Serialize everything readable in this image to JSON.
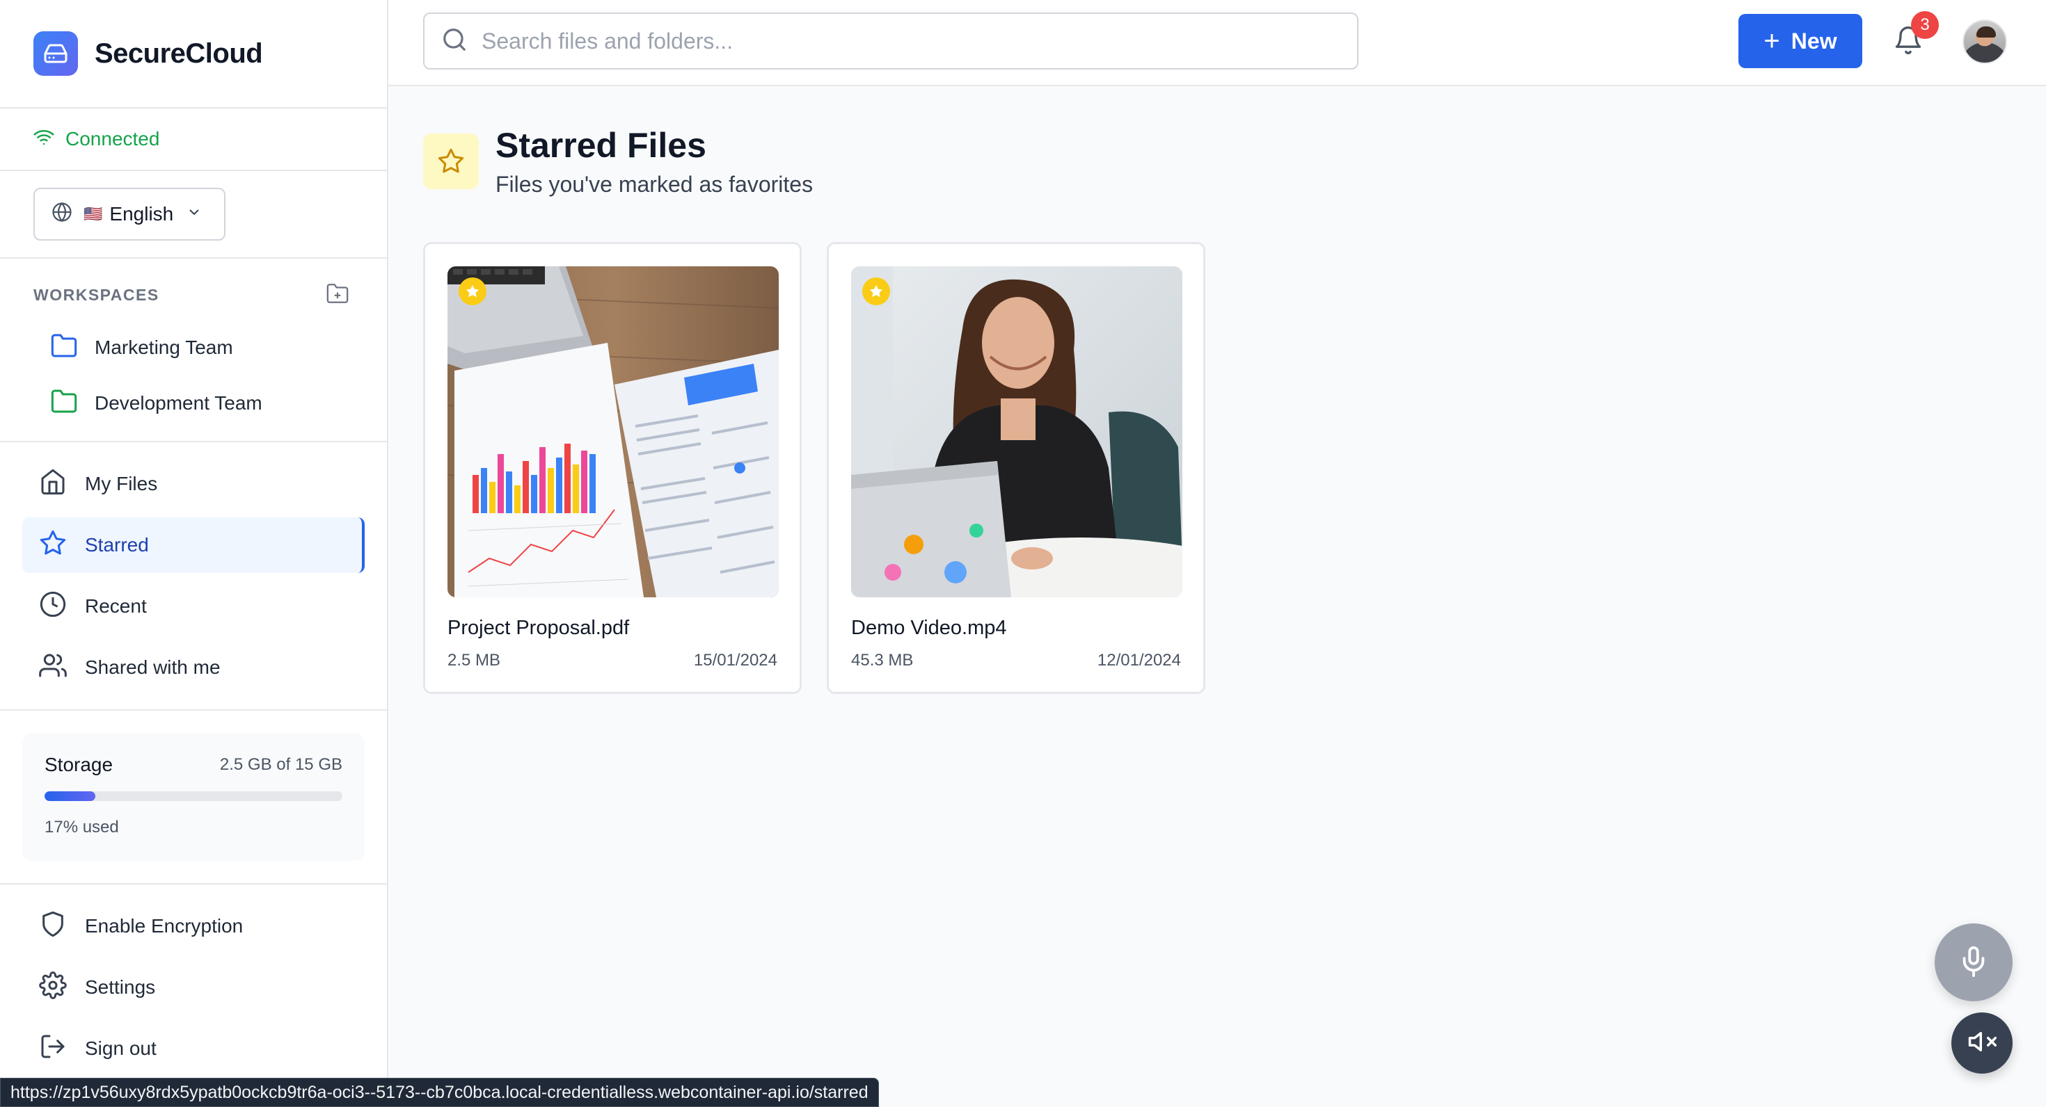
{
  "brand": {
    "name": "SecureCloud"
  },
  "connection": {
    "status": "Connected"
  },
  "language": {
    "flag": "🇺🇸",
    "label": "English"
  },
  "workspaces": {
    "title": "WORKSPACES",
    "items": [
      {
        "label": "Marketing Team",
        "color": "#2563eb"
      },
      {
        "label": "Development Team",
        "color": "#16a34a"
      }
    ]
  },
  "nav": {
    "items": [
      {
        "label": "My Files",
        "icon": "home-icon"
      },
      {
        "label": "Starred",
        "icon": "star-icon",
        "active": true
      },
      {
        "label": "Recent",
        "icon": "clock-icon"
      },
      {
        "label": "Shared with me",
        "icon": "users-icon"
      }
    ]
  },
  "storage": {
    "label": "Storage",
    "amount": "2.5 GB of 15 GB",
    "used_fraction": 0.17,
    "used_text": "17% used"
  },
  "bottom_nav": {
    "items": [
      {
        "label": "Enable Encryption",
        "icon": "shield-icon"
      },
      {
        "label": "Settings",
        "icon": "gear-icon"
      },
      {
        "label": "Sign out",
        "icon": "sign-out-icon"
      }
    ]
  },
  "header": {
    "search_placeholder": "Search files and folders...",
    "new_label": "New",
    "notification_count": "3"
  },
  "page": {
    "title": "Starred Files",
    "subtitle": "Files you've marked as favorites"
  },
  "files": [
    {
      "name": "Project Proposal.pdf",
      "size": "2.5 MB",
      "date": "15/01/2024",
      "starred": true
    },
    {
      "name": "Demo Video.mp4",
      "size": "45.3 MB",
      "date": "12/01/2024",
      "starred": true
    }
  ],
  "status_bar": {
    "url": "https://zp1v56uxy8rdx5ypatb0ockcb9tr6a-oci3--5173--cb7c0bca.local-credentialless.webcontainer-api.io/starred"
  },
  "colors": {
    "accent": "#2563eb",
    "connected": "#16a34a",
    "star": "#facc15",
    "badge": "#ef4444"
  }
}
